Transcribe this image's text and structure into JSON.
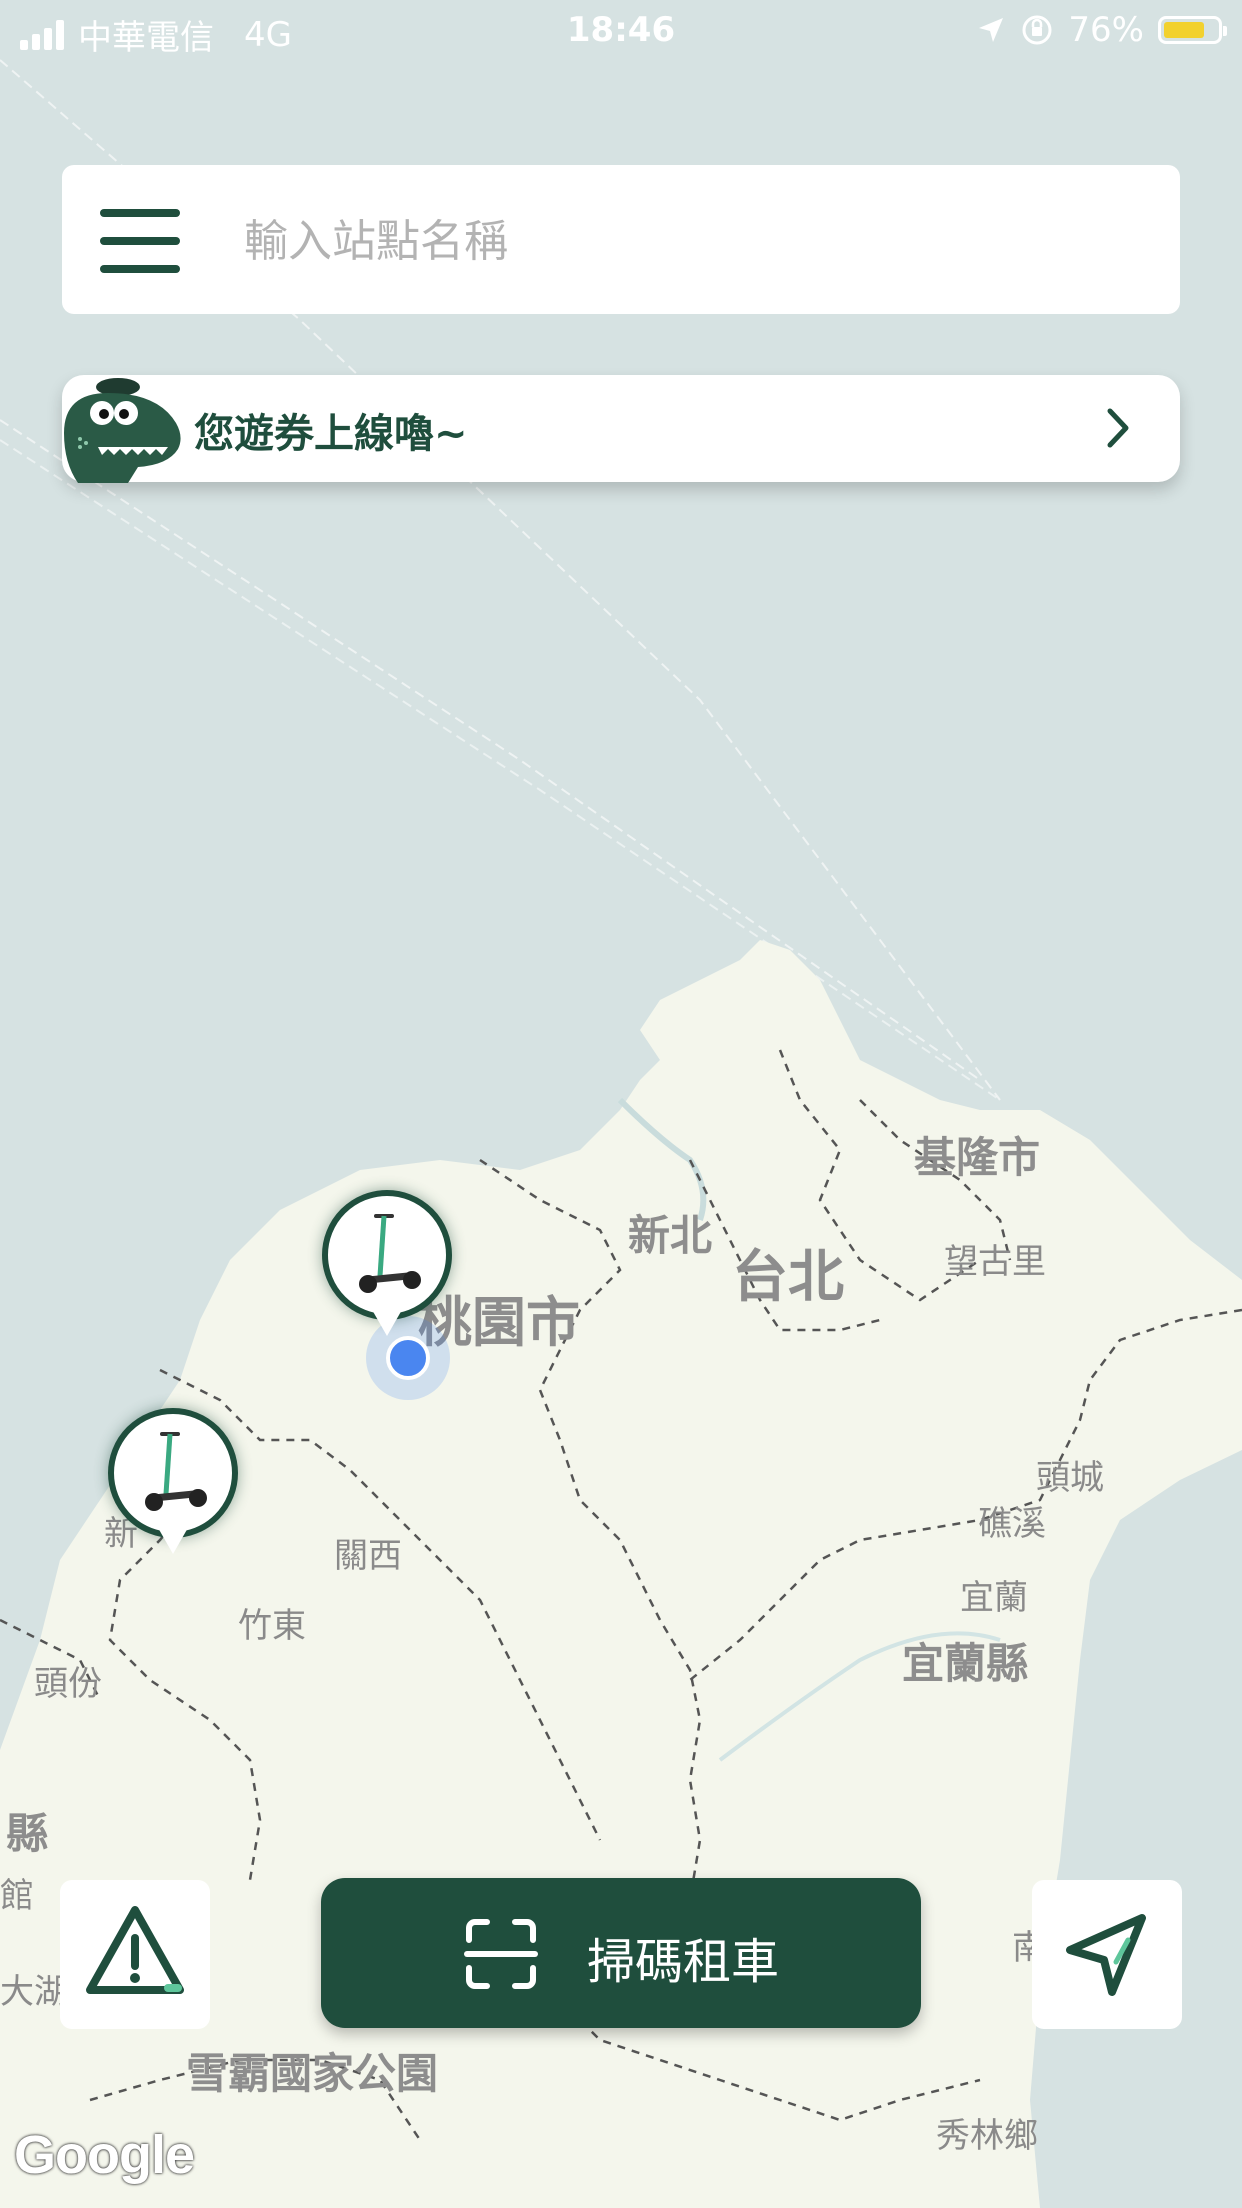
{
  "status_bar": {
    "carrier": "中華電信",
    "network": "4G",
    "time": "18:46",
    "battery_percent": "76%",
    "battery_level": 0.76
  },
  "search": {
    "placeholder": "輸入站點名稱"
  },
  "promo": {
    "text": "您遊券上線嚕~"
  },
  "map": {
    "labels": {
      "keelung": "基隆市",
      "wanggu": "望古里",
      "newtaipei": "新北",
      "taipei": "台北",
      "taoyuan": "桃園市",
      "toucheng": "頭城",
      "jiaoxi": "礁溪",
      "yilan": "宜蘭",
      "yilan_county": "宜蘭縣",
      "guanxi": "關西",
      "zhudong": "竹東",
      "toufen": "頭份",
      "hsinchu": "新",
      "county_fragment": "縣",
      "guan_fragment": "館",
      "dahu": "大湖",
      "nan_fragment": "南",
      "shei_pa": "雪霸國家公園",
      "xiulin": "秀林鄉"
    }
  },
  "scan_button": {
    "label": "掃碼租車"
  },
  "google_logo": "Google",
  "colors": {
    "brand_green": "#1f4e3d",
    "map_sea": "#d6e2e2",
    "map_land": "#f4f6ec",
    "user_location": "#4a86f0",
    "battery": "#f2d12e"
  }
}
